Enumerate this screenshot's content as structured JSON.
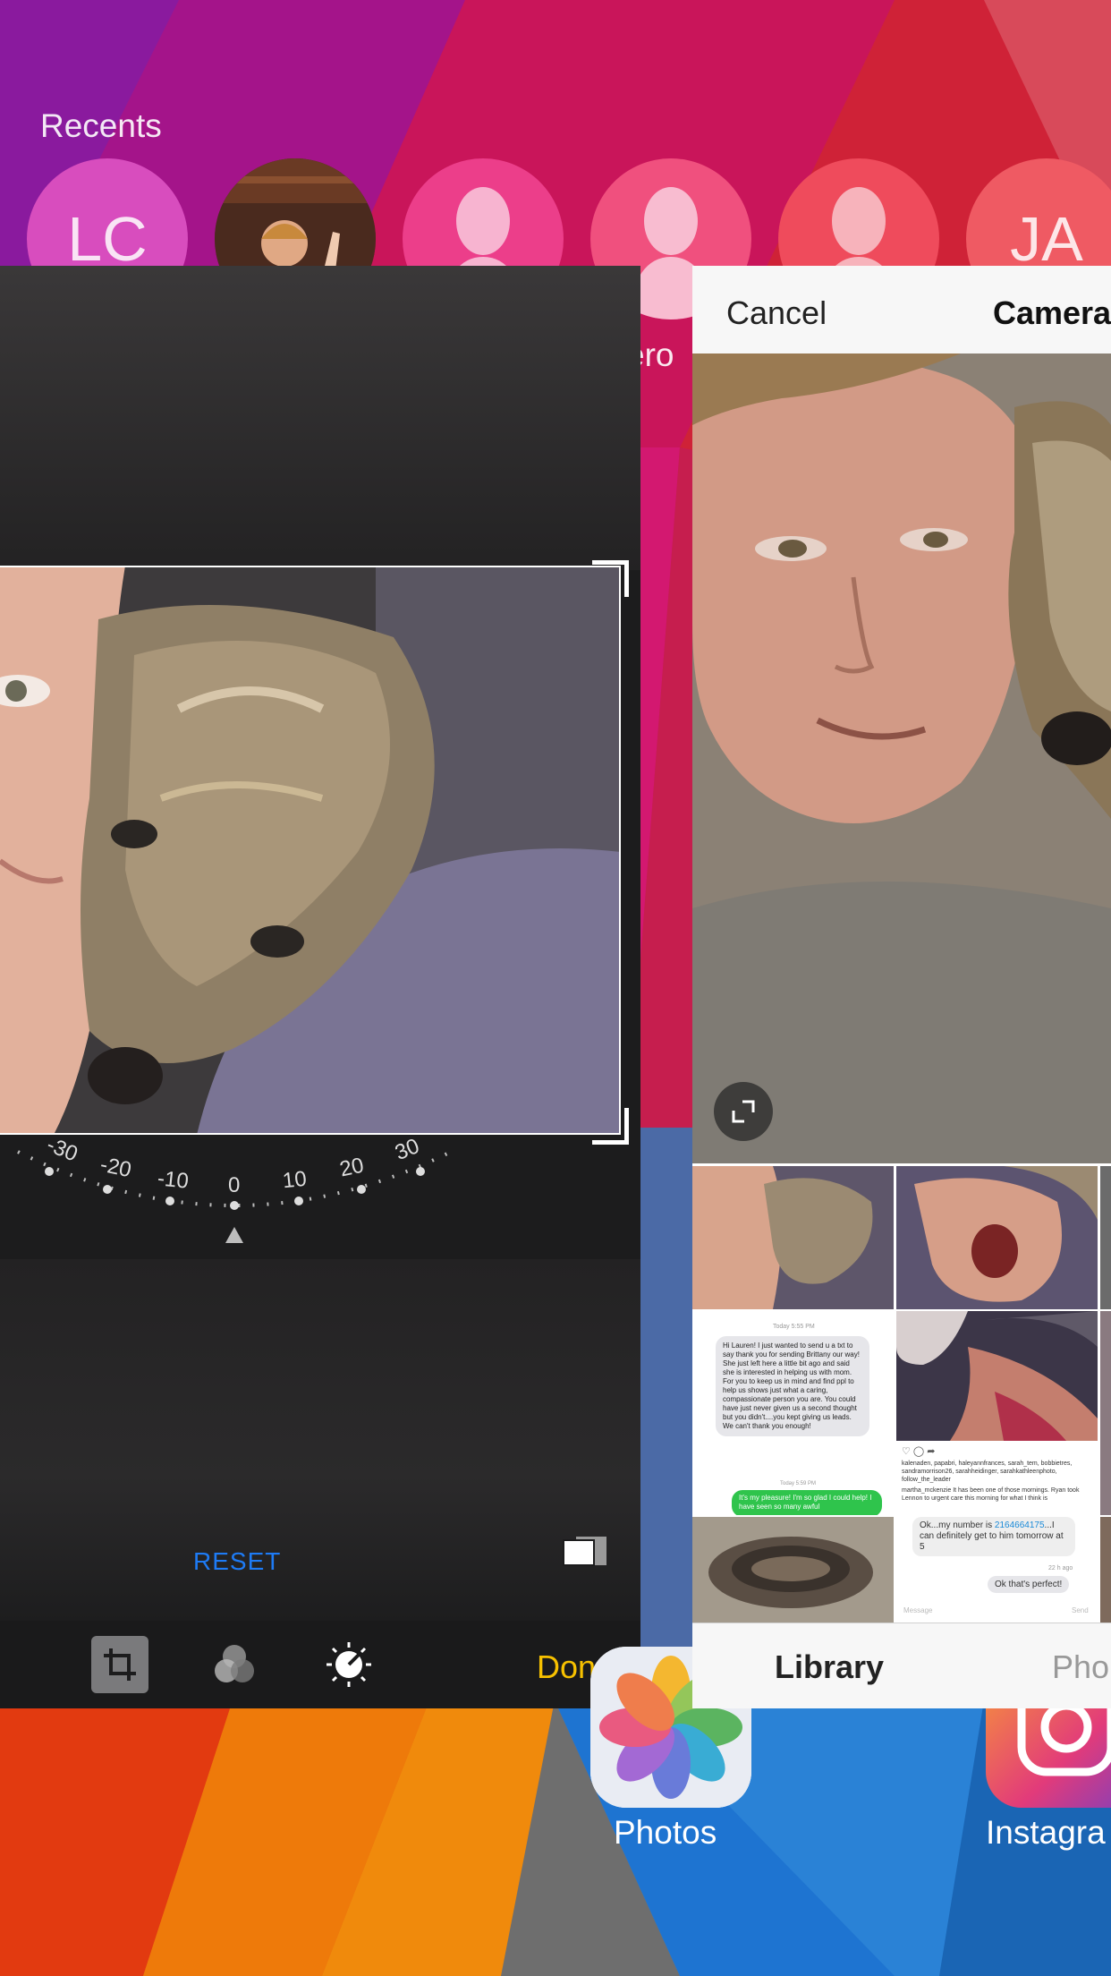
{
  "recents": {
    "label": "Recents",
    "contacts": [
      {
        "initials": "LC",
        "color": "#d84dbe"
      },
      {
        "initials": "",
        "type": "photo"
      },
      {
        "initials": "",
        "type": "silhouette",
        "color": "#ec3e8a"
      },
      {
        "initials": "",
        "type": "silhouette",
        "color": "#f0507e",
        "name_fragment": "ero"
      },
      {
        "initials": "",
        "type": "silhouette",
        "color": "#ef4b5c"
      },
      {
        "initials": "JA",
        "color": "#ef5a63"
      }
    ]
  },
  "editor": {
    "dial_ticks": [
      "-30",
      "-20",
      "-10",
      "0",
      "10",
      "20",
      "30"
    ],
    "reset_label": "RESET",
    "done_label": "Done",
    "tools": [
      "crop-icon",
      "filters-icon",
      "adjust-icon"
    ],
    "colors": {
      "accent_done": "#f7c100",
      "accent_reset": "#1e7bf5"
    }
  },
  "picker": {
    "cancel_label": "Cancel",
    "title": "Camera",
    "tabs": {
      "library": "Library",
      "photo": "Pho"
    },
    "message_thumb": {
      "header": "Today 5:55 PM",
      "body": "Hi Lauren! I just wanted to send u a txt to say thank you for sending Brittany our way! She just left here a little bit ago and said she is interested in helping us with mom. For you to keep us in mind and find ppl to help us shows just what a caring, compassionate person you are. You could have just never given us a second thought but you didn't....you kept giving us leads. We can't thank you enough!",
      "time2": "Today 5:59 PM",
      "reply": "It's my pleasure! I'm so glad I could help! I have seen so many awful"
    },
    "insta_thumb": {
      "likes": "kalenaden, papabri, haleyannfrances, sarah_tem, bobbietres, sandramorrison26, sarahheidinger, sarahkathleenphoto, follow_the_leader",
      "caption": "martha_mckenzie It has been one of those mornings. Ryan took Lennon to urgent care this morning for what I think is"
    },
    "chat_thumb": {
      "msg1": "Ok...my number is",
      "number": "2164664175",
      "msg1b": "...I can definitely get to him tomorrow at 5",
      "time": "22 h ago",
      "msg2": "Ok that's perfect!",
      "placeholder": "Message",
      "send": "Send"
    }
  },
  "home": {
    "apps": [
      {
        "label": "Photos"
      },
      {
        "label": "Instagra"
      }
    ]
  }
}
